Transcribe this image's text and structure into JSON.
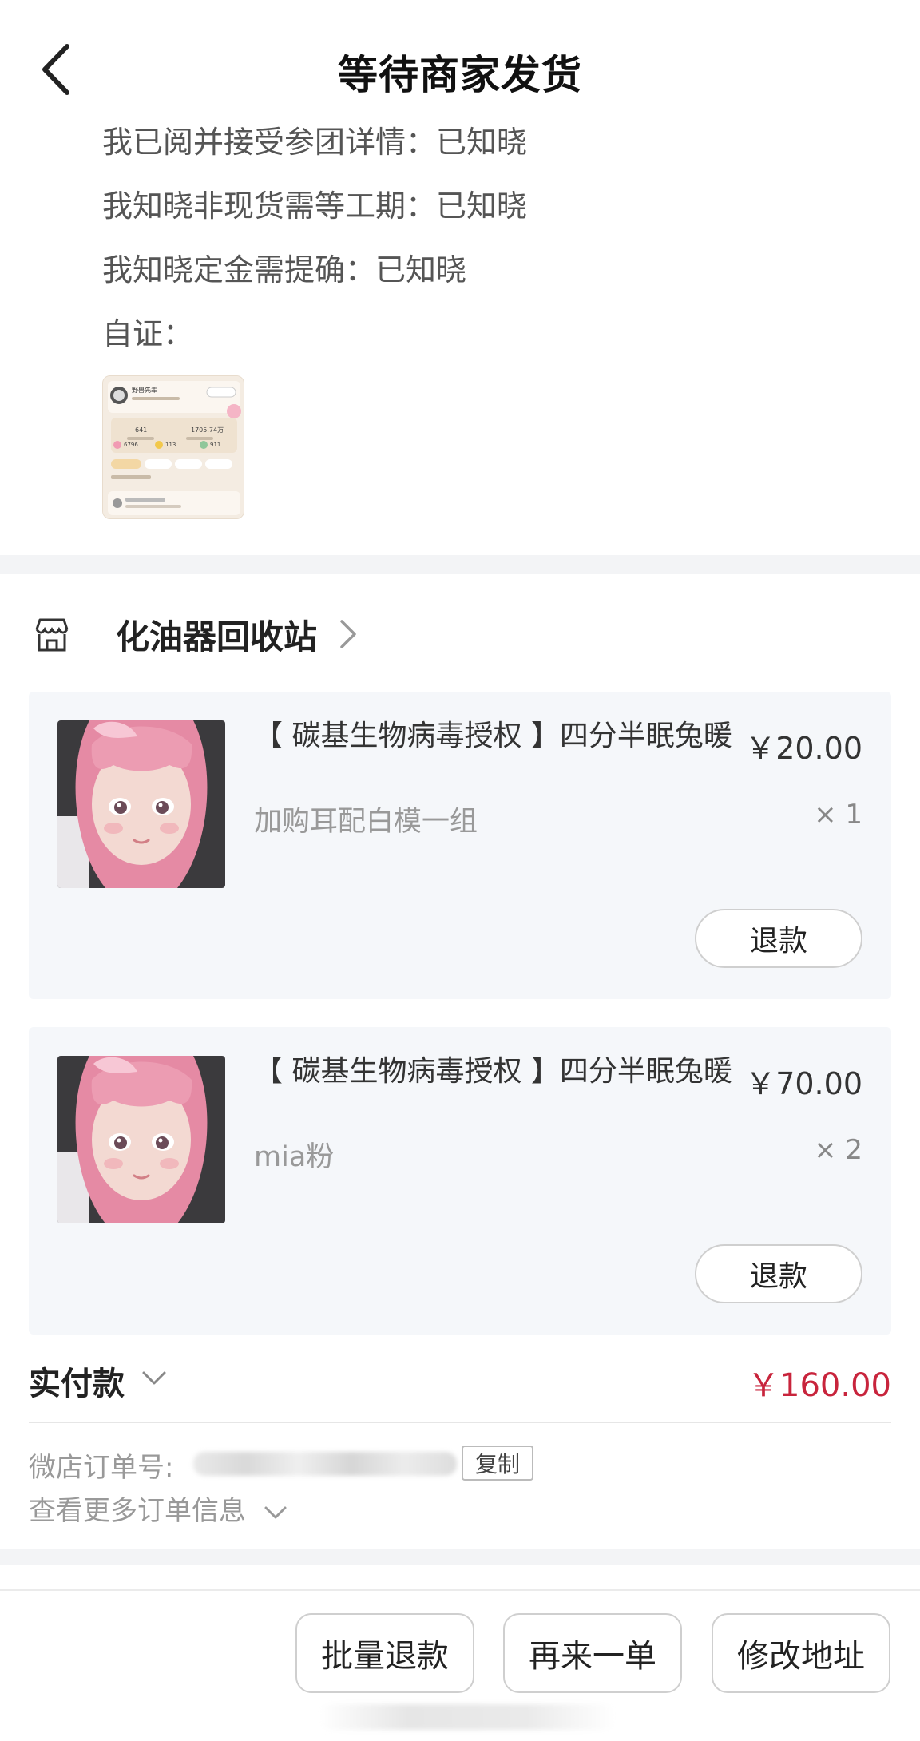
{
  "header": {
    "title": "等待商家发货"
  },
  "notes": {
    "lines": [
      "我已阅并接受参团详情：已知晓",
      "我知晓非现货需等工期：已知晓",
      "我知晓定金需提确：已知晓"
    ],
    "proof_label": "自证：",
    "proof_thumb": {
      "name": "野兽先辈",
      "stat_left": "641",
      "stat_right": "1705.74万",
      "stat_a": "6796",
      "stat_b": "113",
      "stat_c": "911"
    }
  },
  "shop": {
    "name": "化油器回收站"
  },
  "items": [
    {
      "title": "【 碳基生物病毒授权 】四分半眠兔暖",
      "spec": "加购耳配白模一组",
      "price": "￥20.00",
      "qty": "× 1",
      "refund_label": "退款"
    },
    {
      "title": "【 碳基生物病毒授权 】四分半眠兔暖",
      "spec": "mia粉",
      "price": "￥70.00",
      "qty": "× 2",
      "refund_label": "退款"
    }
  ],
  "payment": {
    "label": "实付款",
    "amount": "￥160.00"
  },
  "order": {
    "number_label": "微店订单号:",
    "copy_label": "复制",
    "more_info_label": "查看更多订单信息"
  },
  "actions": {
    "batch_refund": "批量退款",
    "reorder": "再来一单",
    "modify_address": "修改地址"
  },
  "colors": {
    "accent_price": "#c8243c",
    "card_bg": "#f5f7fa"
  }
}
